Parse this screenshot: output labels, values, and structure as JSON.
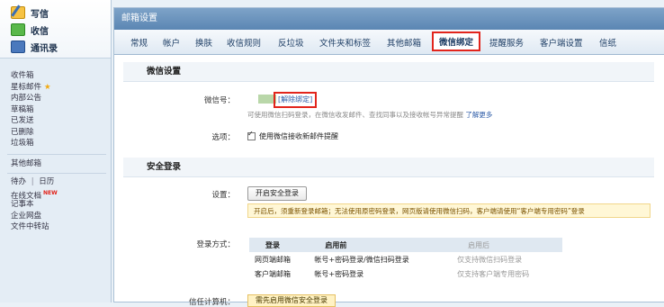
{
  "sidebar": {
    "actions": [
      {
        "label": "写信",
        "icon": "compose-icon"
      },
      {
        "label": "收信",
        "icon": "inbox-icon"
      },
      {
        "label": "通讯录",
        "icon": "contacts-icon"
      }
    ],
    "folders": [
      "收件箱",
      "星标邮件",
      "内部公告",
      "草稿箱",
      "已发送",
      "已删除",
      "垃圾箱"
    ],
    "other_mail": "其他邮箱",
    "tools": {
      "todo": "待办",
      "sep": "|",
      "calendar": "日历",
      "online_docs": "在线文档",
      "new_badge": "NEW",
      "notes": "记事本",
      "netdisk": "企业网盘",
      "transfer": "文件中转站"
    }
  },
  "main": {
    "title": "邮箱设置",
    "tabs": [
      "常规",
      "帐户",
      "换肤",
      "收信规则",
      "反垃圾",
      "文件夹和标签",
      "其他邮箱",
      "微信绑定",
      "提醒服务",
      "客户端设置",
      "信纸"
    ],
    "active_tab": "微信绑定",
    "wechat_section": {
      "title": "微信设置",
      "id_label": "微信号：",
      "unbind_link": "[解除绑定]",
      "hint": "可使用微信扫码登录，在微信收发邮件、查找同事以及接收帐号异常提醒",
      "learn_more": "了解更多",
      "option_label": "选项：",
      "option_text": "使用微信接收新邮件提醒"
    },
    "security_section": {
      "title": "安全登录",
      "settings_label": "设置：",
      "enable_button": "开启安全登录",
      "notice": "开启后，须重新登录邮箱；无法使用原密码登录，网页版请使用微信扫码，客户端请使用“客户端专用密码”登录",
      "method_label": "登录方式：",
      "table": {
        "headers": [
          "登录",
          "启用前",
          "启用后"
        ],
        "rows": [
          [
            "网页端邮箱",
            "帐号+密码登录/微信扫码登录",
            "仅支持微信扫码登录"
          ],
          [
            "客户端邮箱",
            "帐号+密码登录",
            "仅支持客户端专用密码"
          ]
        ]
      },
      "trusted_label": "信任计算机：",
      "trusted_button": "需先启用微信安全登录"
    }
  }
}
